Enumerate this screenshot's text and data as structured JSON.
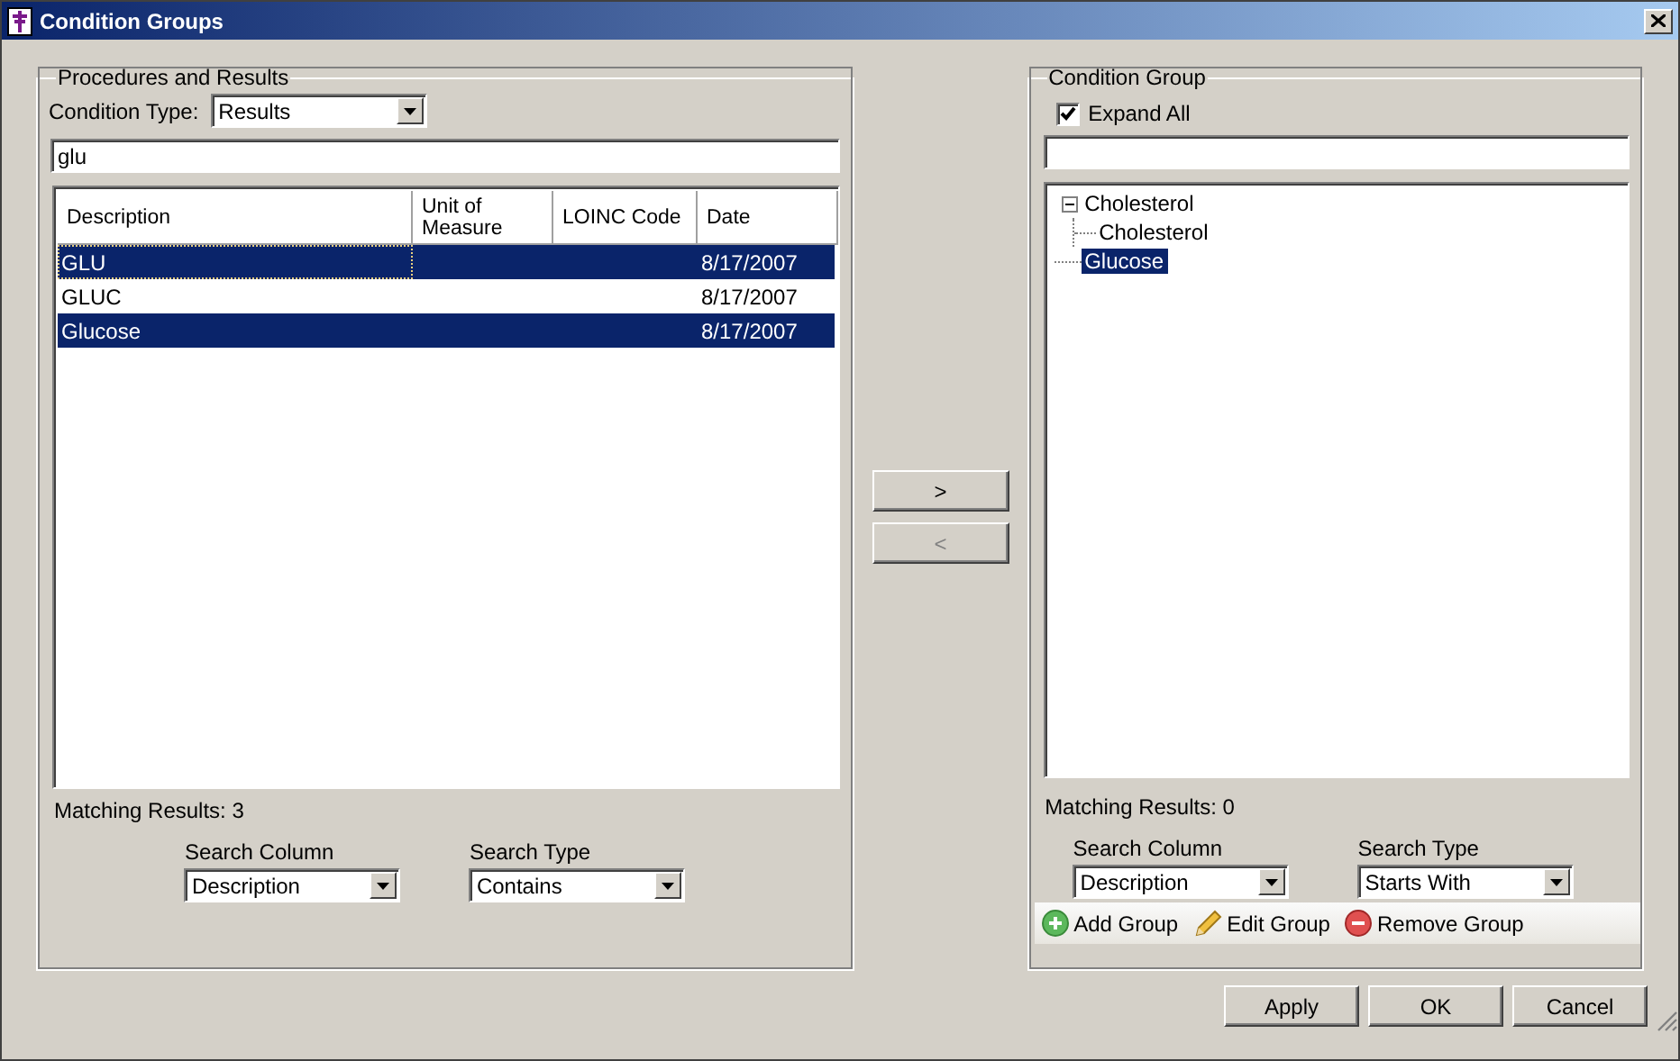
{
  "window": {
    "title": "Condition Groups"
  },
  "procedures": {
    "title": "Procedures and Results",
    "condition_type": {
      "label": "Condition Type:",
      "value": "Results"
    },
    "search": {
      "value": "glu"
    },
    "table": {
      "columns": [
        {
          "label": "Description"
        },
        {
          "label": "Unit of Measure"
        },
        {
          "label": "LOINC Code"
        },
        {
          "label": "Date"
        }
      ],
      "rows": [
        {
          "cells": [
            "GLU",
            "",
            "",
            "8/17/2007"
          ],
          "selected": true,
          "focused": true
        },
        {
          "cells": [
            "GLUC",
            "",
            "",
            "8/17/2007"
          ],
          "selected": false,
          "focused": false
        },
        {
          "cells": [
            "Glucose",
            "",
            "",
            "8/17/2007"
          ],
          "selected": true,
          "focused": false
        }
      ]
    },
    "matching": "Matching Results: 3",
    "search_column": {
      "label": "Search Column",
      "value": "Description"
    },
    "search_type": {
      "label": "Search Type",
      "value": "Contains"
    }
  },
  "transfer_buttons": [
    {
      "label": ">",
      "disabled": false
    },
    {
      "label": "<",
      "disabled": true
    }
  ],
  "condition_group": {
    "title": "Condition Group",
    "expand_all": {
      "label": "Expand All",
      "checked": true
    },
    "tree": [
      {
        "label": "Cholesterol",
        "expanded": true,
        "selected": false,
        "children": [
          {
            "label": "Cholesterol",
            "selected": false
          }
        ]
      },
      {
        "label": "Glucose",
        "selected": true
      }
    ],
    "matching": "Matching Results: 0",
    "search_column": {
      "label": "Search Column",
      "value": "Description"
    },
    "search_type": {
      "label": "Search Type",
      "value": "Starts With"
    },
    "toolbar": [
      {
        "kind": "add",
        "label": "Add Group"
      },
      {
        "kind": "edit",
        "label": "Edit Group"
      },
      {
        "kind": "remove",
        "label": "Remove Group"
      }
    ]
  },
  "buttons": [
    "Apply",
    "OK",
    "Cancel"
  ]
}
